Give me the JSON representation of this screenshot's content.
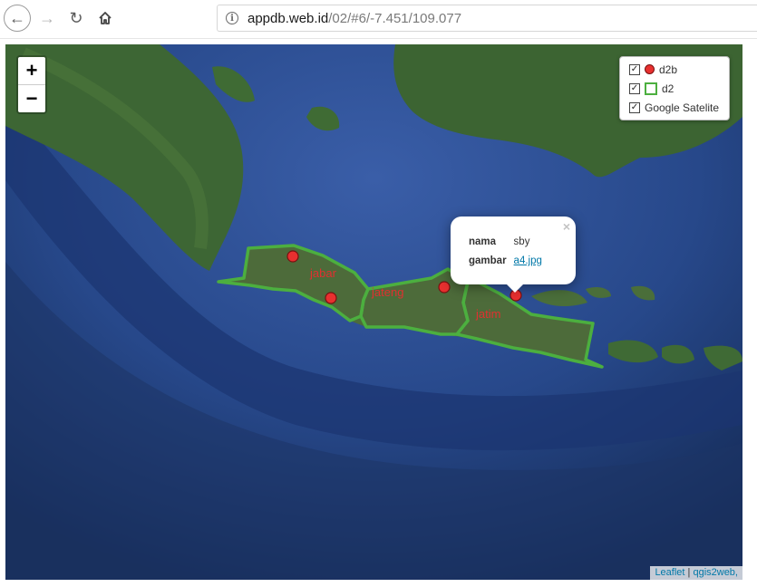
{
  "browser": {
    "url_host": "appdb.web.id",
    "url_path": "/02/#6/-7.451/109.077"
  },
  "map": {
    "zoom_in_label": "+",
    "zoom_out_label": "−",
    "layers": [
      {
        "label": "d2b",
        "checked": true,
        "symbol": "red-dot"
      },
      {
        "label": "d2",
        "checked": true,
        "symbol": "green-outline-polygon"
      },
      {
        "label": "Google Satelite",
        "checked": true,
        "symbol": "none"
      }
    ],
    "province_labels": [
      "jabar",
      "jateng",
      "jatim"
    ],
    "popup": {
      "close": "×",
      "fields": [
        {
          "key": "nama",
          "value": "sby"
        },
        {
          "key": "gambar",
          "value": "a4.jpg"
        }
      ]
    },
    "attribution": {
      "leaflet": "Leaflet",
      "separator": " | ",
      "qgis": "qgis2web,"
    },
    "colors": {
      "polygon_stroke": "#4caf3f",
      "point_fill": "#e8302f",
      "label": "#e03030"
    }
  }
}
